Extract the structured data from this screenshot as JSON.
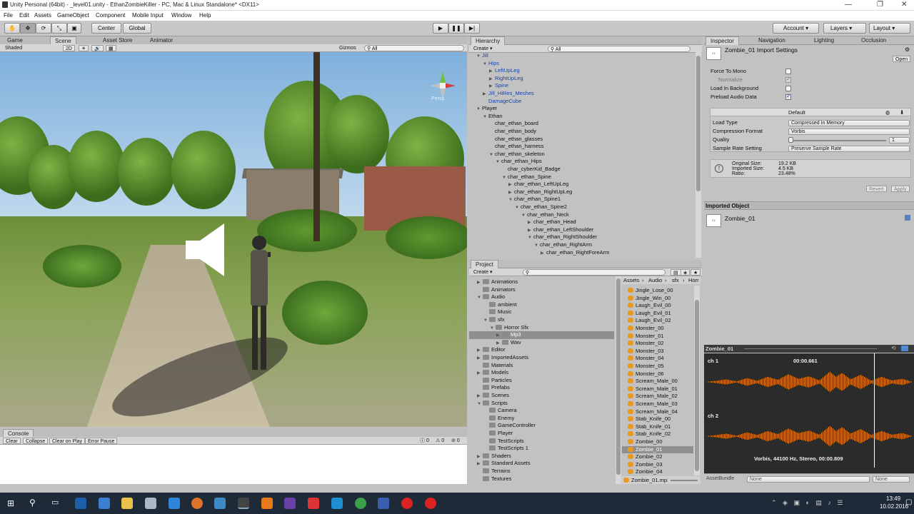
{
  "window": {
    "title": "Unity Personal (64bit) - _level01.unity - EthanZombieKiller - PC, Mac & Linux Standalone* <DX11>",
    "controls": [
      "—",
      "❐",
      "✕"
    ]
  },
  "menu": [
    "File",
    "Edit",
    "Assets",
    "GameObject",
    "Component",
    "Mobile Input",
    "Window",
    "Help"
  ],
  "toolbar": {
    "center_label": "Center",
    "global_label": "Global",
    "account_label": "Account",
    "layers_label": "Layers",
    "layout_label": "Layout"
  },
  "scene_panel": {
    "tabs": [
      "Game",
      "Scene",
      "Asset Store",
      "Animator"
    ],
    "shading": "Shaded",
    "mode_2d": "2D",
    "gizmos_label": "Gizmos",
    "search_placeholder": "All",
    "persp_label": "Persp"
  },
  "console_panel": {
    "tab": "Console",
    "buttons": [
      "Clear",
      "Collapse",
      "Clear on Play",
      "Error Pause"
    ],
    "counts": [
      "0",
      "0",
      "0"
    ]
  },
  "hierarchy": {
    "tab": "Hierarchy",
    "create_label": "Create",
    "search_placeholder": "All",
    "rows": [
      {
        "label": "Jill",
        "indent": 0,
        "arrow": "▼",
        "blue": true
      },
      {
        "label": "Hips",
        "indent": 1,
        "arrow": "▼",
        "blue": true
      },
      {
        "label": "LeftUpLeg",
        "indent": 2,
        "arrow": "▶",
        "blue": true
      },
      {
        "label": "RightUpLeg",
        "indent": 2,
        "arrow": "▶",
        "blue": true
      },
      {
        "label": "Spine",
        "indent": 2,
        "arrow": "▶",
        "blue": true
      },
      {
        "label": "Jill_HiRes_Meshes",
        "indent": 1,
        "arrow": "▶",
        "blue": true
      },
      {
        "label": "DamageCube",
        "indent": 1,
        "arrow": "",
        "blue": true
      },
      {
        "label": "Player",
        "indent": 0,
        "arrow": "▼",
        "blue": false
      },
      {
        "label": "Ethan",
        "indent": 1,
        "arrow": "▼",
        "blue": false
      },
      {
        "label": "char_ethan_board",
        "indent": 2,
        "arrow": "",
        "blue": false
      },
      {
        "label": "char_ethan_body",
        "indent": 2,
        "arrow": "",
        "blue": false
      },
      {
        "label": "char_ethan_glasses",
        "indent": 2,
        "arrow": "",
        "blue": false
      },
      {
        "label": "char_ethan_harness",
        "indent": 2,
        "arrow": "",
        "blue": false
      },
      {
        "label": "char_ethan_skeleton",
        "indent": 2,
        "arrow": "▼",
        "blue": false
      },
      {
        "label": "char_ethan_Hips",
        "indent": 3,
        "arrow": "▼",
        "blue": false
      },
      {
        "label": "char_cyberKid_Badge",
        "indent": 4,
        "arrow": "",
        "blue": false
      },
      {
        "label": "char_ethan_Spine",
        "indent": 4,
        "arrow": "▼",
        "blue": false
      },
      {
        "label": "char_ethan_LeftUpLeg",
        "indent": 5,
        "arrow": "▶",
        "blue": false
      },
      {
        "label": "char_ethan_RightUpLeg",
        "indent": 5,
        "arrow": "▶",
        "blue": false
      },
      {
        "label": "char_ethan_Spine1",
        "indent": 5,
        "arrow": "▼",
        "blue": false
      },
      {
        "label": "char_ethan_Spine2",
        "indent": 6,
        "arrow": "▼",
        "blue": false
      },
      {
        "label": "char_ethan_Neck",
        "indent": 7,
        "arrow": "▼",
        "blue": false
      },
      {
        "label": "char_ethan_Head",
        "indent": 8,
        "arrow": "▶",
        "blue": false
      },
      {
        "label": "char_ethan_LeftShoulder",
        "indent": 8,
        "arrow": "▶",
        "blue": false
      },
      {
        "label": "char_ethan_RightShoulder",
        "indent": 8,
        "arrow": "▼",
        "blue": false
      },
      {
        "label": "char_ethan_RightArm",
        "indent": 9,
        "arrow": "▼",
        "blue": false
      },
      {
        "label": "char_ethan_RightForeArm",
        "indent": 10,
        "arrow": "▶",
        "blue": false
      }
    ]
  },
  "project": {
    "tab": "Project",
    "create_label": "Create",
    "breadcrumb": [
      "Assets",
      "Audio",
      "sfx",
      "Horr"
    ],
    "tree": [
      {
        "label": "Animations",
        "indent": 1,
        "arrow": "▶"
      },
      {
        "label": "Animators",
        "indent": 1,
        "arrow": ""
      },
      {
        "label": "Audio",
        "indent": 1,
        "arrow": "▼"
      },
      {
        "label": "ambient",
        "indent": 2,
        "arrow": ""
      },
      {
        "label": "Music",
        "indent": 2,
        "arrow": ""
      },
      {
        "label": "sfx",
        "indent": 2,
        "arrow": "▼"
      },
      {
        "label": "Horror Sfx",
        "indent": 3,
        "arrow": "▼"
      },
      {
        "label": "Mp3",
        "indent": 4,
        "arrow": "▶",
        "selected": true
      },
      {
        "label": "Wav",
        "indent": 4,
        "arrow": "▶"
      },
      {
        "label": "Editor",
        "indent": 1,
        "arrow": "▶"
      },
      {
        "label": "ImportedAssets",
        "indent": 1,
        "arrow": "▶"
      },
      {
        "label": "Materials",
        "indent": 1,
        "arrow": ""
      },
      {
        "label": "Models",
        "indent": 1,
        "arrow": "▶"
      },
      {
        "label": "Particles",
        "indent": 1,
        "arrow": ""
      },
      {
        "label": "Prefabs",
        "indent": 1,
        "arrow": ""
      },
      {
        "label": "Scenes",
        "indent": 1,
        "arrow": "▶"
      },
      {
        "label": "Scripts",
        "indent": 1,
        "arrow": "▼"
      },
      {
        "label": "Camera",
        "indent": 2,
        "arrow": ""
      },
      {
        "label": "Enemy",
        "indent": 2,
        "arrow": ""
      },
      {
        "label": "GameController",
        "indent": 2,
        "arrow": ""
      },
      {
        "label": "Player",
        "indent": 2,
        "arrow": ""
      },
      {
        "label": "TestScripts",
        "indent": 2,
        "arrow": ""
      },
      {
        "label": "TestScripts 1",
        "indent": 2,
        "arrow": ""
      },
      {
        "label": "Shaders",
        "indent": 1,
        "arrow": "▶"
      },
      {
        "label": "Standard Assets",
        "indent": 1,
        "arrow": "▶"
      },
      {
        "label": "Terrains",
        "indent": 1,
        "arrow": ""
      },
      {
        "label": "Textures",
        "indent": 1,
        "arrow": ""
      }
    ],
    "files": [
      "Jingle_Lose_00",
      "Jingle_Win_00",
      "Laugh_Evil_00",
      "Laugh_Evil_01",
      "Laugh_Evil_02",
      "Monster_00",
      "Monster_01",
      "Monster_02",
      "Monster_03",
      "Monster_04",
      "Monster_05",
      "Monster_06",
      "Scream_Male_00",
      "Scream_Male_01",
      "Scream_Male_02",
      "Scream_Male_03",
      "Scream_Male_04",
      "Stab_Knife_00",
      "Stab_Knife_01",
      "Stab_Knife_02",
      "Zombie_00",
      "Zombie_01",
      "Zombie_02",
      "Zombie_03",
      "Zombie_04"
    ],
    "selected_file": "Zombie_01",
    "footer_file": "Zombie_01.mp3"
  },
  "inspector": {
    "tabs": [
      "Inspector",
      "Navigation",
      "Lighting",
      "Occlusion"
    ],
    "title": "Zombie_01 Import Settings",
    "open_label": "Open",
    "force_to_mono": "Force To Mono",
    "normalize": "Normalize",
    "load_in_background": "Load In Background",
    "preload_audio_data": "Preload Audio Data",
    "platform_tab": "Default",
    "load_type_label": "Load Type",
    "load_type_value": "Compressed In Memory",
    "compression_label": "Compression Format",
    "compression_value": "Vorbis",
    "quality_label": "Quality",
    "quality_value": "1",
    "sample_rate_label": "Sample Rate Setting",
    "sample_rate_value": "Preserve Sample Rate",
    "original_size": "Original Size:",
    "original_size_value": "19.2 KB",
    "imported_size": "Imported Size:",
    "imported_size_value": "4.5 KB",
    "ratio": "Ratio:",
    "ratio_value": "23.48%",
    "revert_label": "Revert",
    "apply_label": "Apply",
    "imported_object_header": "Imported Object",
    "imported_object_name": "Zombie_01",
    "preview_name": "Zombie_01",
    "ch1_label": "ch 1",
    "ch2_label": "ch 2",
    "time": "00:00.661",
    "info": "Vorbis, 44100 Hz, Stereo, 00:00.809",
    "asset_bundle_label": "AssetBundle",
    "asset_bundle_value": "None",
    "asset_bundle_variant": "None"
  },
  "taskbar": {
    "time": "13:49",
    "date": "10.02.2016"
  },
  "colors": {
    "waveform": "#f08a1a",
    "editor_bg": "#c2c2c2",
    "hierarchy_link": "#1a45a6"
  }
}
